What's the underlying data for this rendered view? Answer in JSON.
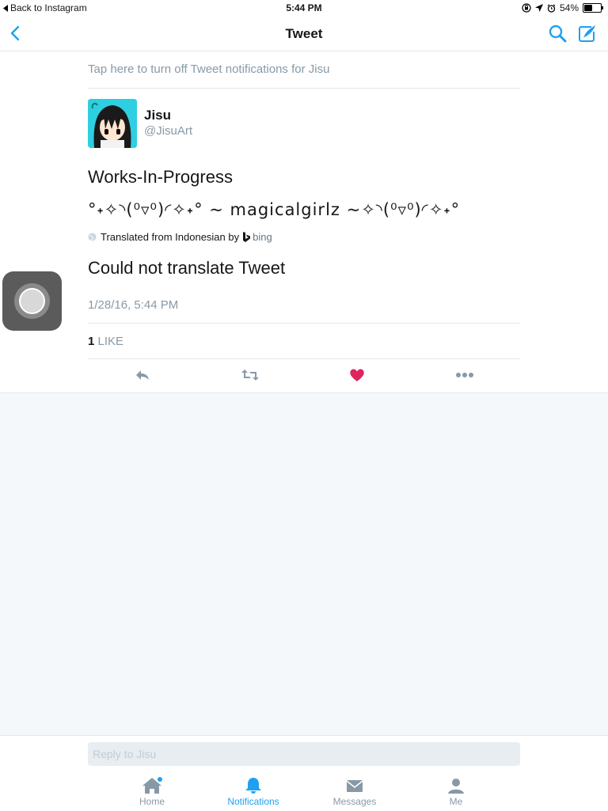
{
  "status_bar": {
    "back_label": "Back to Instagram",
    "time": "5:44 PM",
    "battery_percent": "54%",
    "battery_level": 0.54
  },
  "nav": {
    "title": "Tweet",
    "accent_color": "#1da1f2"
  },
  "tweet": {
    "notification_banner": "Tap here to turn off Tweet notifications for Jisu",
    "author_name": "Jisu",
    "author_handle": "@JisuArt",
    "text_line1": "Works-In-Progress",
    "text_line2": "°˖✧◝(⁰▿⁰)◜✧˖° ~ magicalgirlz ~✧◝(⁰▿⁰)◜✧˖°",
    "translation_label": "Translated from Indonesian by",
    "translation_provider": "bing",
    "translation_error": "Could not translate Tweet",
    "timestamp": "1/28/16, 5:44 PM",
    "like_count": "1",
    "like_label": "LIKE",
    "liked": true,
    "like_color": "#e0245e"
  },
  "reply": {
    "placeholder": "Reply to Jisu",
    "value": ""
  },
  "tabs": [
    {
      "label": "Home",
      "icon": "home-icon",
      "active": false,
      "has_dot": true
    },
    {
      "label": "Notifications",
      "icon": "bell-icon",
      "active": true,
      "has_dot": false
    },
    {
      "label": "Messages",
      "icon": "envelope-icon",
      "active": false,
      "has_dot": false
    },
    {
      "label": "Me",
      "icon": "person-icon",
      "active": false,
      "has_dot": false
    }
  ]
}
